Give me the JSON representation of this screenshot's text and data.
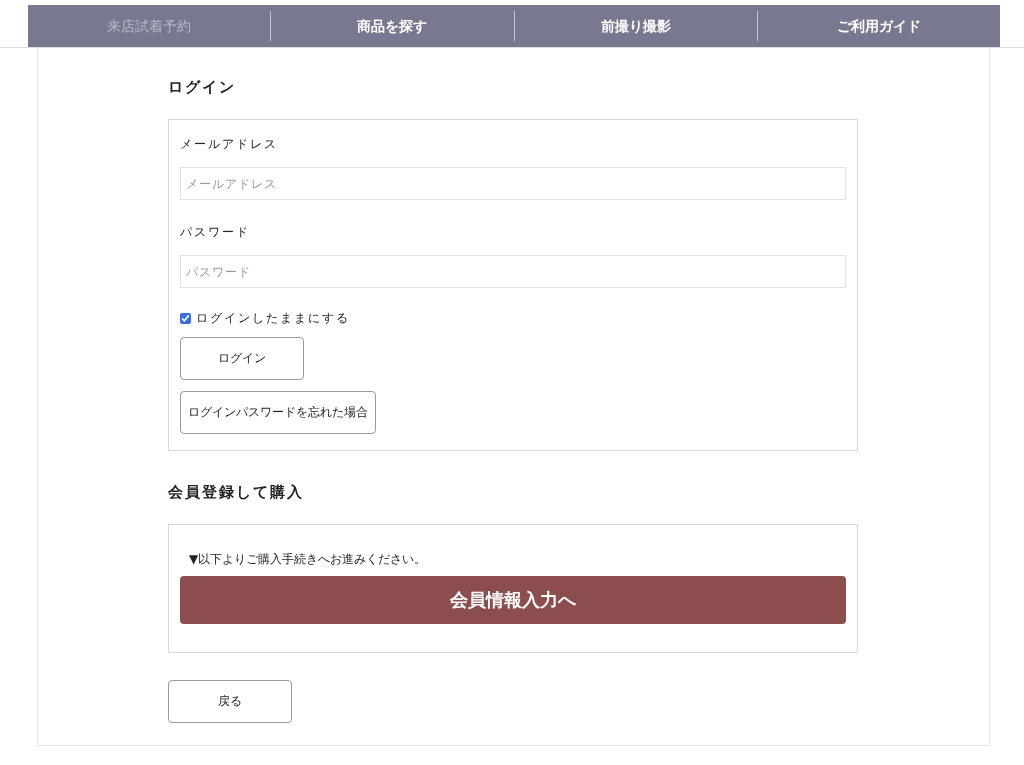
{
  "nav": [
    {
      "label": "来店試着予約",
      "selected": true
    },
    {
      "label": "商品を探す",
      "selected": false
    },
    {
      "label": "前撮り撮影",
      "selected": false
    },
    {
      "label": "ご利用ガイド",
      "selected": false
    }
  ],
  "login": {
    "title": "ログイン",
    "fields": [
      {
        "label": "メールアドレス",
        "placeholder": "メールアドレス"
      },
      {
        "label": "パスワード",
        "placeholder": "パスワード"
      }
    ],
    "remember": {
      "label": "ログインしたままにする",
      "checked": true
    },
    "login_button": "ログイン",
    "forgot_button": "ログインパスワードを忘れた場合"
  },
  "register": {
    "title": "会員登録して購入",
    "note": "▼以下よりご購入手続きへお進みください。",
    "button": "会員情報入力へ"
  },
  "back_button": "戻る"
}
